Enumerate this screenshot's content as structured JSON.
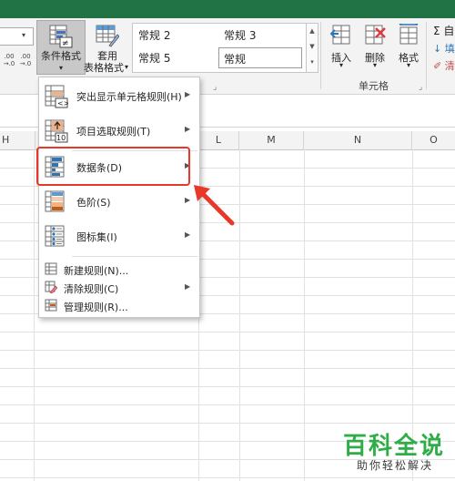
{
  "ribbon": {
    "number_format_buttons": [
      ".00 →.0",
      ".00 →.0"
    ],
    "conditional_format": {
      "label": "条件格式"
    },
    "table_format": {
      "label_line1": "套用",
      "label_line2": "表格格式"
    },
    "styles_gallery": {
      "cells": [
        "常规 2",
        "常规 3",
        "常规 5",
        "常规"
      ]
    },
    "cells_group": {
      "buttons": [
        {
          "label": "插入"
        },
        {
          "label": "删除"
        },
        {
          "label": "格式"
        }
      ],
      "group_label": "单元格"
    },
    "right_tools": [
      "Σ 自",
      "↓ 填",
      "✐ 清"
    ]
  },
  "columns": {
    "left_header": "H",
    "headers": [
      "L",
      "M",
      "N",
      "O"
    ]
  },
  "menu": {
    "items": [
      {
        "label": "突出显示单元格规则(H)",
        "has_submenu": true,
        "icon": "highlight-cells-icon"
      },
      {
        "label": "项目选取规则(T)",
        "has_submenu": true,
        "icon": "top-bottom-rules-icon"
      },
      {
        "label": "数据条(D)",
        "has_submenu": true,
        "icon": "data-bars-icon"
      },
      {
        "label": "色阶(S)",
        "has_submenu": true,
        "icon": "color-scales-icon"
      },
      {
        "label": "图标集(I)",
        "has_submenu": true,
        "icon": "icon-sets-icon"
      }
    ],
    "small_items": [
      {
        "label": "新建规则(N)...",
        "has_submenu": false,
        "icon": "new-rule-icon"
      },
      {
        "label": "清除规则(C)",
        "has_submenu": true,
        "icon": "clear-rules-icon"
      },
      {
        "label": "管理规则(R)...",
        "has_submenu": false,
        "icon": "manage-rules-icon"
      }
    ]
  },
  "annotation": {
    "highlight_color": "#e8382a"
  },
  "watermark": {
    "title": "百科全说",
    "subtitle": "助你轻松解决",
    "color": "#2fae47"
  },
  "colors": {
    "title_bar": "#217346",
    "ribbon_bg": "#f3f3f3"
  }
}
